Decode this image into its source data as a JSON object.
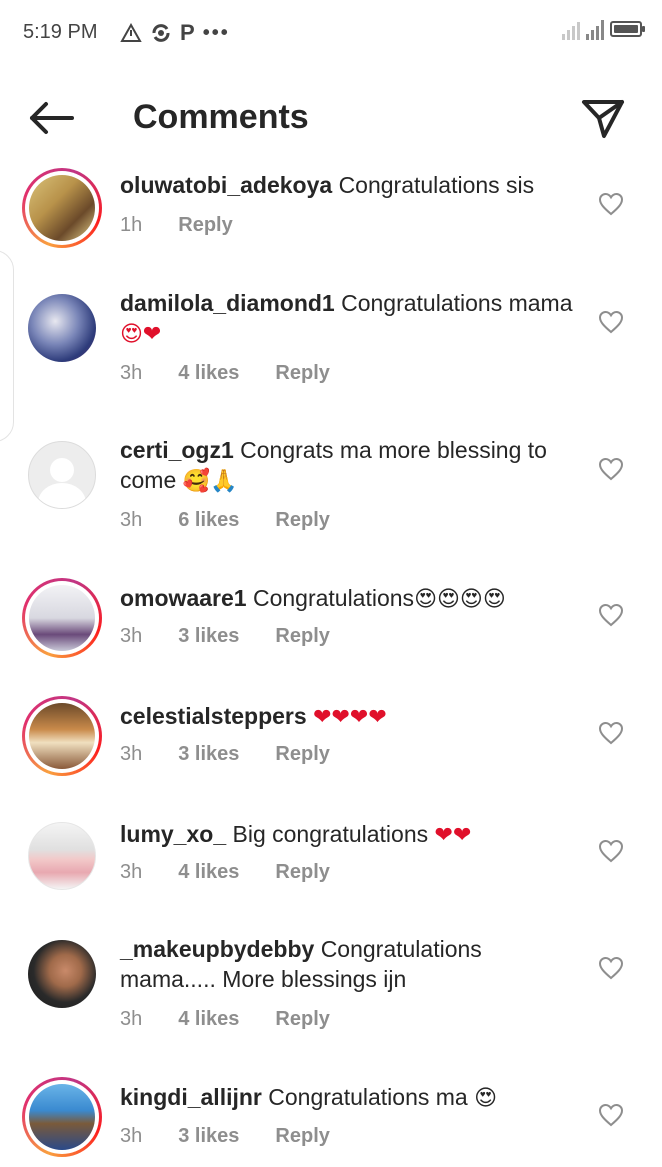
{
  "status_bar": {
    "time": "5:19 PM",
    "indicator_p": "P",
    "indicator_dots": "•••",
    "icons": [
      "triangle-icon",
      "sync-icon",
      "p-icon",
      "more-dots-icon",
      "signal-icon",
      "signal-icon",
      "battery-icon"
    ]
  },
  "header": {
    "title": "Comments",
    "back_icon": "arrow-left-icon",
    "share_icon": "send-icon"
  },
  "comments": [
    {
      "username": "oluwatobi_adekoya",
      "text": "Congratulations sis",
      "time": "1h",
      "likes": "",
      "reply": "Reply"
    },
    {
      "username": "damilola_diamond1",
      "text": "Congratulations mama",
      "emoji": "😍❤",
      "time": "3h",
      "likes": "4 likes",
      "reply": "Reply"
    },
    {
      "username": "certi_ogz1",
      "text": "Congrats ma more blessing to come",
      "emoji": "🥰🙏",
      "time": "3h",
      "likes": "6 likes",
      "reply": "Reply"
    },
    {
      "username": "omowaare1",
      "text": "Congratulations",
      "emoji": "😍😍😍😍",
      "time": "3h",
      "likes": "3 likes",
      "reply": "Reply"
    },
    {
      "username": "celestialsteppers",
      "text": "",
      "emoji": "❤❤❤❤",
      "time": "3h",
      "likes": "3 likes",
      "reply": "Reply"
    },
    {
      "username": "lumy_xo_",
      "text": "Big congratulations",
      "emoji": "❤❤",
      "time": "3h",
      "likes": "4 likes",
      "reply": "Reply"
    },
    {
      "username": "_makeupbydebby",
      "text": "Congratulations mama..... More blessings ijn",
      "time": "3h",
      "likes": "4 likes",
      "reply": "Reply"
    },
    {
      "username": "kingdi_allijnr",
      "text": "Congratulations ma",
      "emoji": "😍",
      "time": "3h",
      "likes": "3 likes",
      "reply": "Reply"
    }
  ],
  "colors": {
    "ring_gradient": [
      "#f9a03f",
      "#e1306c",
      "#c13584"
    ],
    "heart_emoji": "#e0102b",
    "muted_text": "#8e8e8e",
    "primary_text": "#262626"
  }
}
